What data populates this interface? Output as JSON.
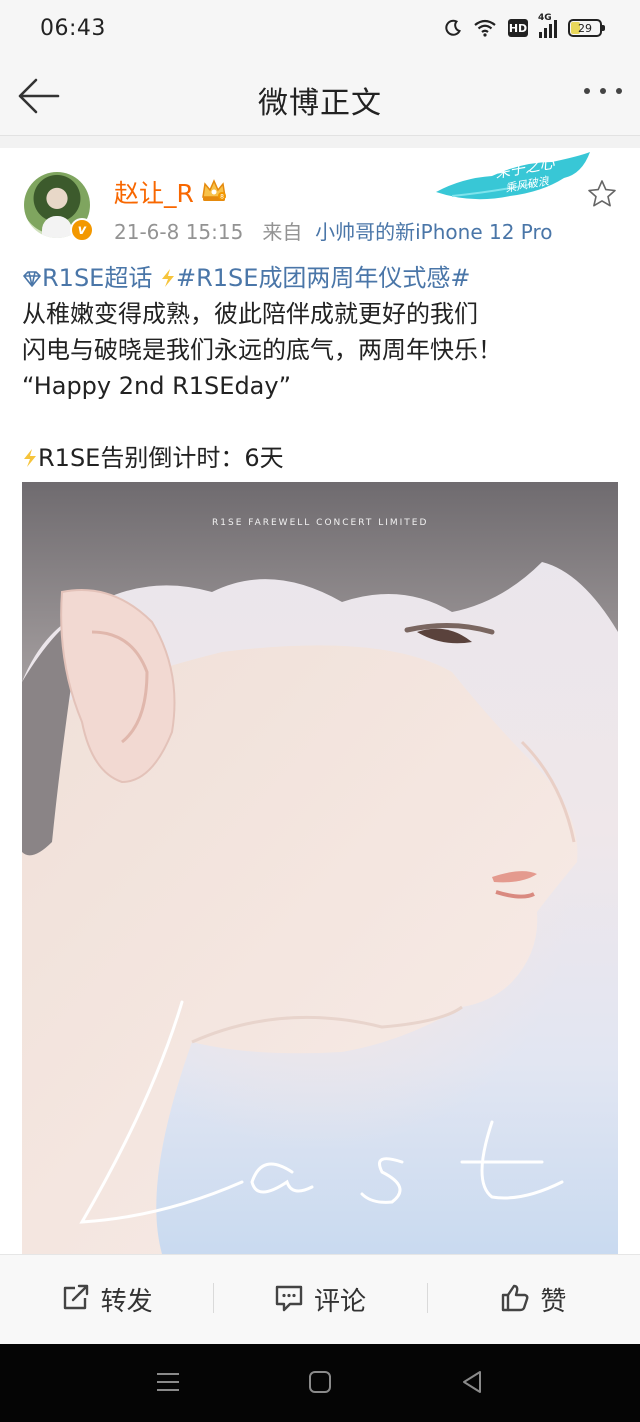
{
  "status_bar": {
    "time": "06:43",
    "battery_level": "29",
    "hd_label": "HD",
    "network_label": "4G",
    "icons": [
      "moon-icon",
      "wifi-icon",
      "hd-icon",
      "signal-4g-icon",
      "battery-icon"
    ]
  },
  "nav": {
    "title": "微博正文",
    "back_icon": "arrow-left-icon",
    "more_icon": "more-dots-icon"
  },
  "post": {
    "author": "赵让_R",
    "date": "21-6-8 15:15",
    "from_label": "来自",
    "source": "小帅哥的新iPhone 12 Pro",
    "verified": true,
    "accent_color": "#f86700",
    "link_color": "#4a76a8",
    "lines": {
      "tag1": "R1SE超话",
      "tag2": "#R1SE成团两周年仪式感#",
      "line2": "从稚嫩变得成熟，彼此陪伴成就更好的我们",
      "line3": "闪电与破晓是我们永远的底气，两周年快乐！",
      "line4": "“Happy 2nd R1SEday”",
      "line5": "R1SE告别倒计时：6天"
    },
    "image": {
      "caption": "R1SE FAREWELL CONCERT LIMITED",
      "script_text": "Last"
    }
  },
  "actions": {
    "repost": "转发",
    "comment": "评论",
    "like": "赞"
  }
}
